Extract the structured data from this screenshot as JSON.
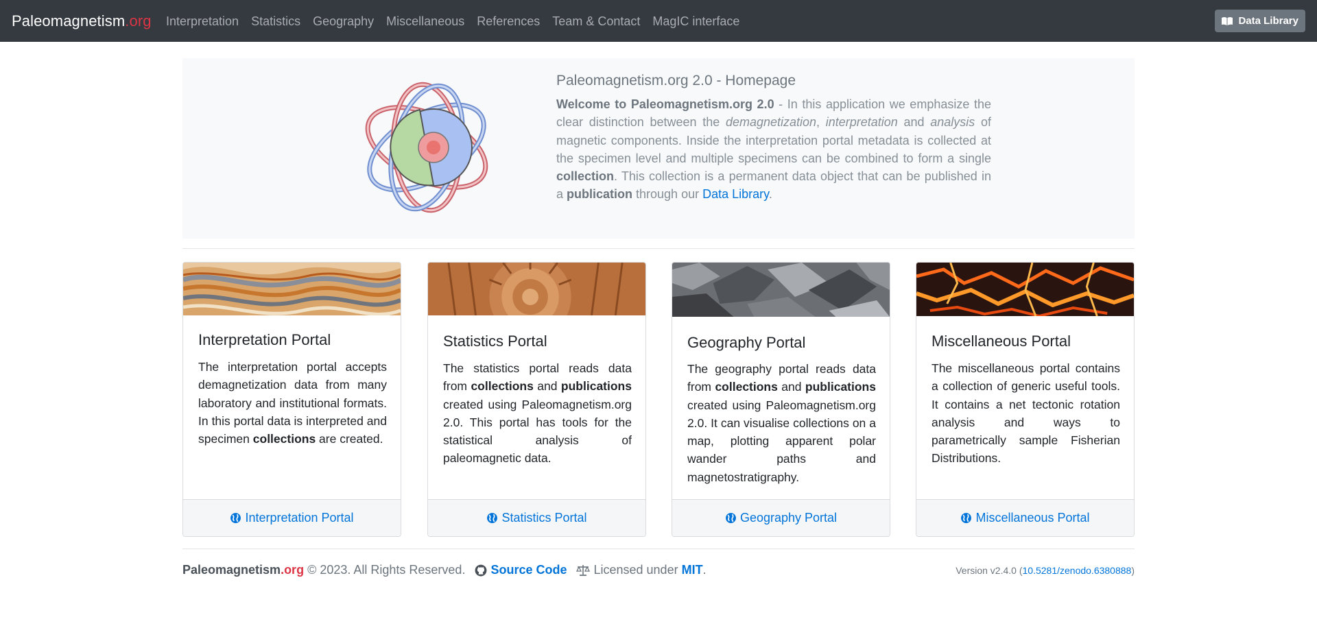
{
  "navbar": {
    "brand_main": "Paleomagnetism",
    "brand_suffix": ".org",
    "links": [
      "Interpretation",
      "Statistics",
      "Geography",
      "Miscellaneous",
      "References",
      "Team & Contact",
      "MagIC interface"
    ],
    "library_button": "Data Library",
    "library_icon": "book-icon"
  },
  "hero": {
    "title": "Paleomagnetism.org 2.0 - Homepage",
    "intro_bold": "Welcome to Paleomagnetism.org 2.0",
    "t1": " - In this application we emphasize the clear distinction between the ",
    "em1": "demagnetization",
    "t2": ", ",
    "em2": "interpretation",
    "t3": " and ",
    "em3": "analysis",
    "t4": " of magnetic components. Inside the interpretation portal metadata is collected at the specimen level and multiple specimens can be combined to form a single ",
    "b1": "collection",
    "t5": ". This collection is a permanent data object that can be published in a ",
    "b2": "publication",
    "t6": " through our ",
    "link": "Data Library",
    "t7": "."
  },
  "cards": [
    {
      "title": "Interpretation Portal",
      "p1": "The interpretation portal accepts demagnetization data from many laboratory and institutional formats. In this portal data is interpreted and specimen ",
      "b1": "collections",
      "p2": " are created.",
      "footer": "Interpretation Portal",
      "icon": "globe-icon"
    },
    {
      "title": "Statistics Portal",
      "p1": "The statistics portal reads data from ",
      "b1": "collections",
      "p2": " and ",
      "b2": "publications",
      "p3": " created using Paleomagnetism.org 2.0. This portal has tools for the statistical analysis of paleomagnetic data.",
      "footer": "Statistics Portal",
      "icon": "globe-icon"
    },
    {
      "title": "Geography Portal",
      "p1": "The geography portal reads data from ",
      "b1": "collections",
      "p2": " and ",
      "b2": "publications",
      "p3": " created using Paleomagnetism.org 2.0. It can visualise collections on a map, plotting apparent polar wander paths and magnetostratigraphy.",
      "footer": "Geography Portal",
      "icon": "globe-icon"
    },
    {
      "title": "Miscellaneous Portal",
      "p1": "The miscellaneous portal contains a collection of generic useful tools. It contains a net tectonic rotation analysis and ways to parametrically sample Fisherian Distributions.",
      "footer": "Miscellaneous Portal",
      "icon": "globe-icon"
    }
  ],
  "footer": {
    "brand_main": "Paleomagnetism",
    "brand_suffix": ".org",
    "copyright": "© 2023. All Rights Reserved.",
    "source_code": "Source Code",
    "licensed_under": "Licensed under",
    "license": "MIT",
    "period": ".",
    "version_prefix": "Version v2.4.0 (",
    "doi": "10.5281/zenodo.6380888",
    "version_suffix": ")"
  },
  "colors": {
    "navbar_bg": "#343a40",
    "accent_red": "#dc3545",
    "link_blue": "#0074d9",
    "hero_bg": "#f8f9fa"
  }
}
